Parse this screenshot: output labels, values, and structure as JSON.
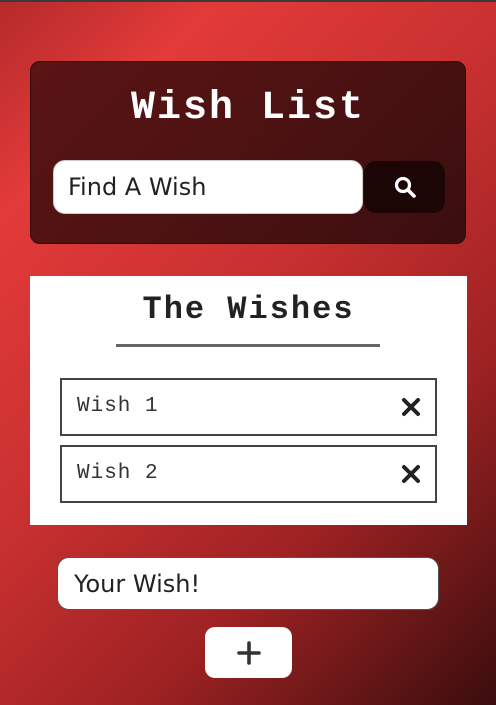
{
  "header": {
    "title": "Wish List",
    "search_placeholder": "Find A Wish",
    "search_icon": "search-icon"
  },
  "wishes_section": {
    "title": "The Wishes",
    "items": [
      {
        "label": "Wish 1",
        "remove_icon": "close-icon"
      },
      {
        "label": "Wish 2",
        "remove_icon": "close-icon"
      }
    ]
  },
  "add_form": {
    "placeholder": "Your Wish!",
    "add_icon": "plus-icon"
  },
  "colors": {
    "background_red": "#e23a39",
    "header_panel": "#4e1212",
    "search_button": "#1b0505",
    "card": "#ffffff"
  }
}
